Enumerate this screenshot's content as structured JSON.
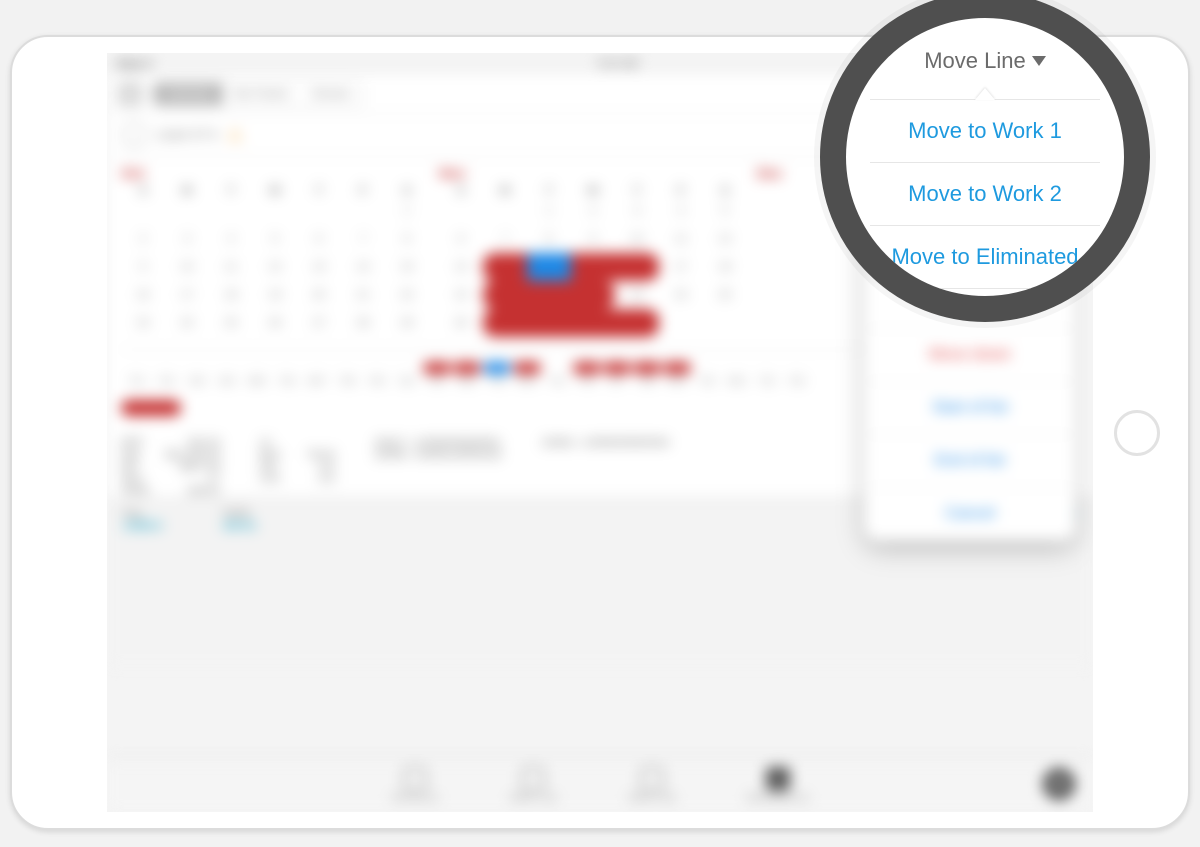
{
  "statusbar": {
    "left": "iPad ᯤ",
    "center": "9:41 AM",
    "right": ""
  },
  "segmented": {
    "items": [
      "Calendar",
      "Bar Packer",
      "Browse"
    ],
    "active": 0
  },
  "legend": {
    "trip": "Trip/Activity",
    "carry": "Carry In"
  },
  "linebar": {
    "label": "Line# 47 ▾",
    "warn": "⚠"
  },
  "months": {
    "oct": {
      "name": "Oct",
      "dow": [
        "S",
        "M",
        "T",
        "W",
        "T",
        "F",
        "S"
      ]
    },
    "nov": {
      "name": "Nov",
      "dow": [
        "S",
        "M",
        "T",
        "W",
        "T",
        "F",
        "S"
      ]
    },
    "dec": {
      "name": "Dec"
    }
  },
  "timeline_labels": [
    "T01",
    "F02",
    "S03",
    "S04",
    "M05",
    "T06",
    "W07",
    "T08",
    "F09",
    "S10",
    "S11",
    "M12",
    "T13",
    "W14",
    "T15",
    "F16",
    "S17",
    "S18",
    "M19",
    "T20",
    "W21",
    "T22",
    "F23"
  ],
  "stats": {
    "left": [
      [
        "FDP",
        "152:24"
      ],
      [
        "Pay",
        "$11,200.00"
      ],
      [
        "DP",
        "$207.00"
      ],
      [
        "OFF",
        "17"
      ],
      [
        "TAFB",
        "190:51"
      ]
    ],
    "mid": [
      [
        "Cr",
        ""
      ],
      [
        "BLK",
        "78:19"
      ],
      [
        "DH",
        "0:0"
      ],
      [
        "C/O",
        "0:0"
      ]
    ],
    "codes": [
      "20317—11556/0056/0501",
      "20356—15462/1405/0102",
      "20362—14556/0056/0540"
    ]
  },
  "footer": {
    "pay_label": "Pay",
    "pay_value": "11562.0",
    "tafb_label": "TAFB",
    "tafb_value": "190:51",
    "dd_title": "Desired Dates Off",
    "dd_pct": "0%",
    "dd_items": "Nov 02   Nov 04"
  },
  "tabs": [
    "Sort by (1)",
    "Work 1 (2)",
    "Work 2 (3)",
    "Eliminated (1)"
  ],
  "sheet": {
    "title": "Move Line",
    "move_up": "Move up",
    "move_down": "Move down",
    "start": "Start of list",
    "end": "End of list",
    "cancel": "Cancel"
  },
  "spotlight": {
    "title": "Move Line",
    "options": [
      "Move to Work 1",
      "Move to Work 2",
      "Move to Eliminated"
    ]
  }
}
